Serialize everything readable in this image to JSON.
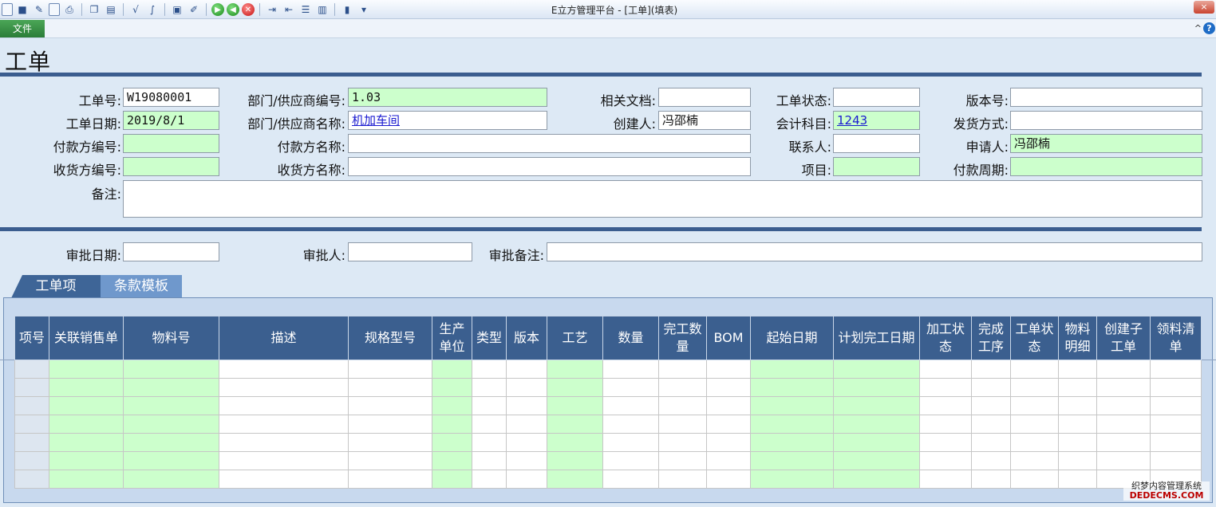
{
  "window": {
    "title": "E立方管理平台 - [工单](填表)",
    "close": "×"
  },
  "toolbar": {
    "icons": [
      "new-icon",
      "save-icon",
      "save-as-icon",
      "preview-icon",
      "print-icon",
      "copy-icon",
      "paste-icon",
      "formula-icon",
      "formula-alt-icon",
      "clipboard-icon",
      "edit-icon",
      "go-forward-icon",
      "go-back-icon",
      "cancel-icon",
      "indent-icon",
      "outdent-icon",
      "list-icon",
      "columns-icon",
      "book-icon",
      "dropdown-icon"
    ]
  },
  "menu": {
    "file": "文件",
    "collapse": "^",
    "help": "?"
  },
  "page": {
    "title": "工单"
  },
  "form": {
    "order_no_label": "工单号:",
    "order_no": "W19080001",
    "dept_code_label": "部门/供应商编号:",
    "dept_code": "1.03",
    "related_doc_label": "相关文档:",
    "related_doc": "",
    "order_status_label": "工单状态:",
    "order_status": "",
    "version_label": "版本号:",
    "version": "",
    "order_date_label": "工单日期:",
    "order_date": "2019/8/1",
    "dept_name_label": "部门/供应商名称:",
    "dept_name": "机加车间",
    "creator_label": "创建人:",
    "creator": "冯邵楠",
    "account_label": "会计科目:",
    "account": "1243",
    "ship_method_label": "发货方式:",
    "ship_method": "",
    "payer_code_label": "付款方编号:",
    "payer_code": "",
    "payer_name_label": "付款方名称:",
    "payer_name": "",
    "contact_label": "联系人:",
    "contact": "",
    "applicant_label": "申请人:",
    "applicant": "冯邵楠",
    "receiver_code_label": "收货方编号:",
    "receiver_code": "",
    "receiver_name_label": "收货方名称:",
    "receiver_name": "",
    "project_label": "项目:",
    "project": "",
    "pay_cycle_label": "付款周期:",
    "pay_cycle": "",
    "remark_label": "备注:",
    "remark": ""
  },
  "approval": {
    "date_label": "审批日期:",
    "date": "",
    "approver_label": "审批人:",
    "approver": "",
    "note_label": "审批备注:",
    "note": ""
  },
  "tabs": [
    {
      "label": "工单项"
    },
    {
      "label": "条款模板"
    }
  ],
  "grid": {
    "columns": [
      "项号",
      "关联销售单",
      "物料号",
      "描述",
      "规格型号",
      "生产单位",
      "类型",
      "版本",
      "工艺",
      "数量",
      "完工数量",
      "BOM",
      "起始日期",
      "计划完工日期",
      "加工状态",
      "完成工序",
      "工单状态",
      "物料明细",
      "创建子工单",
      "领料清单"
    ],
    "green_columns": [
      1,
      2,
      5,
      8,
      12,
      13
    ],
    "row_count": 7
  },
  "watermark": {
    "line1": "织梦内容管理系统",
    "line2": "DEDECMS.COM"
  }
}
